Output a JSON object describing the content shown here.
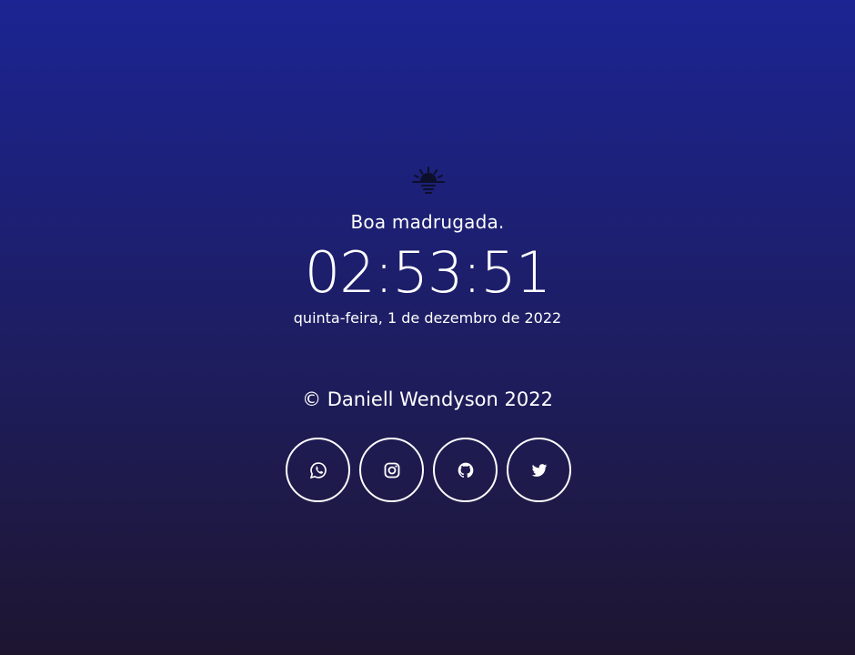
{
  "header": {
    "icon": "sunrise-icon",
    "greeting": "Boa madrugada."
  },
  "clock": {
    "time": "02:53:51",
    "date": "quinta-feira, 1 de dezembro de 2022"
  },
  "footer": {
    "copyright": "© Daniell Wendyson 2022",
    "social_links": [
      {
        "name": "whatsapp",
        "icon": "whatsapp-icon"
      },
      {
        "name": "instagram",
        "icon": "instagram-icon"
      },
      {
        "name": "github",
        "icon": "github-icon"
      },
      {
        "name": "twitter",
        "icon": "twitter-icon"
      }
    ]
  },
  "colors": {
    "background_top": "#1b2492",
    "background_bottom": "#1d1530",
    "text": "#ffffff",
    "sun_icon": "#0d0f2a"
  }
}
